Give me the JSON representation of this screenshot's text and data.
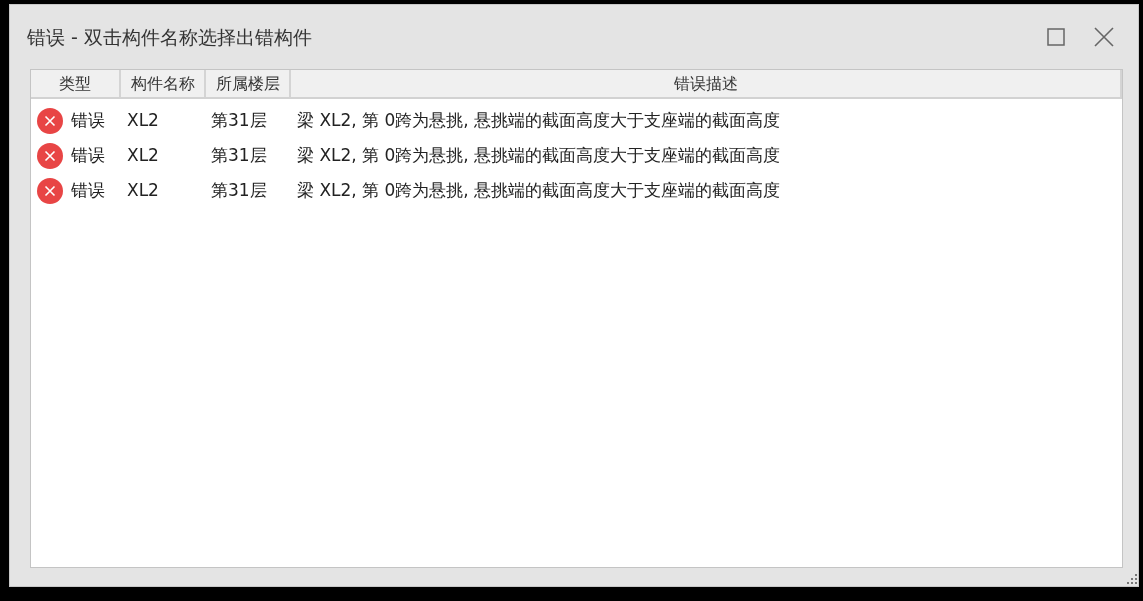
{
  "window": {
    "title": "错误 - 双击构件名称选择出错构件"
  },
  "table": {
    "columns": [
      "类型",
      "构件名称",
      "所属楼层",
      "错误描述"
    ],
    "rows": [
      {
        "kind": "error",
        "type": "错误",
        "name": "XL2",
        "floor": "第31层",
        "description": "梁 XL2, 第 0跨为悬挑, 悬挑端的截面高度大于支座端的截面高度"
      },
      {
        "kind": "error",
        "type": "错误",
        "name": "XL2",
        "floor": "第31层",
        "description": "梁 XL2, 第 0跨为悬挑, 悬挑端的截面高度大于支座端的截面高度"
      },
      {
        "kind": "error",
        "type": "错误",
        "name": "XL2",
        "floor": "第31层",
        "description": "梁 XL2, 第 0跨为悬挑, 悬挑端的截面高度大于支座端的截面高度"
      }
    ]
  }
}
